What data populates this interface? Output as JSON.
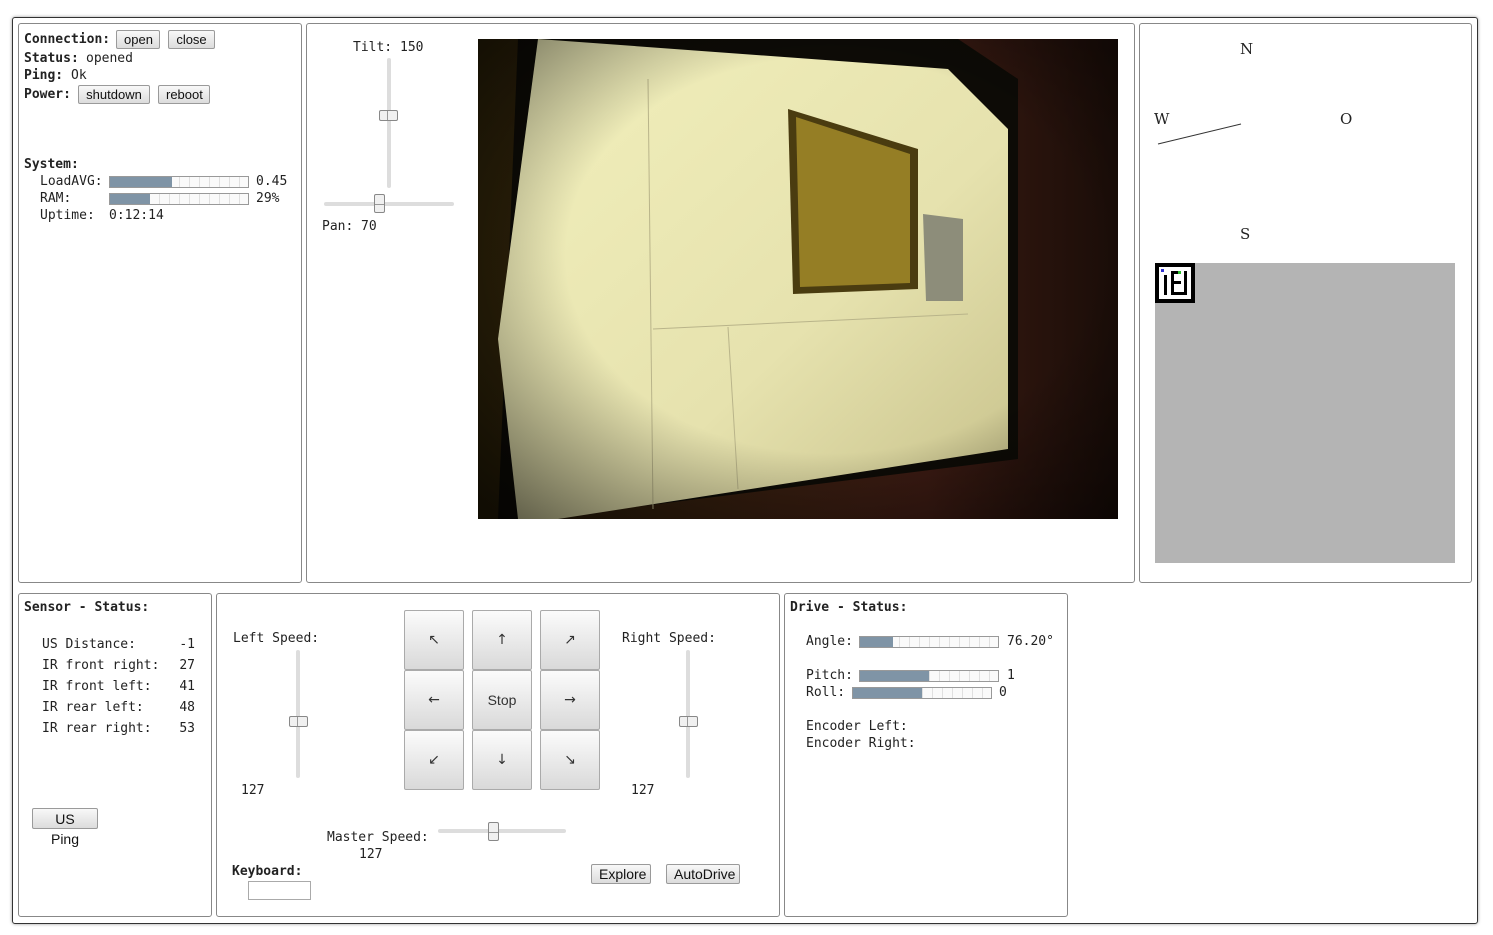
{
  "connection": {
    "label": "Connection:",
    "open_btn": "open",
    "close_btn": "close",
    "status_label": "Status:",
    "status_value": "opened",
    "ping_label": "Ping:",
    "ping_value": "Ok",
    "power_label": "Power:",
    "shutdown_btn": "shutdown",
    "reboot_btn": "reboot"
  },
  "system": {
    "label": "System:",
    "load_label": "LoadAVG:",
    "load_value": "0.45",
    "load_fraction": 0.45,
    "ram_label": "RAM:",
    "ram_value": "29%",
    "ram_fraction": 0.29,
    "uptime_label": "Uptime:",
    "uptime_value": "0:12:14"
  },
  "camera": {
    "tilt_label": "Tilt:",
    "tilt_value": "150",
    "pan_label": "Pan:",
    "pan_value": "70"
  },
  "compass": {
    "north": "N",
    "south": "S",
    "west": "W",
    "east": "O"
  },
  "sensor": {
    "title": "Sensor - Status:",
    "rows": [
      {
        "label": "US Distance:",
        "value": "-1"
      },
      {
        "label": "IR front right:",
        "value": "27"
      },
      {
        "label": "IR front left:",
        "value": "41"
      },
      {
        "label": "IR rear left:",
        "value": "48"
      },
      {
        "label": "IR rear right:",
        "value": "53"
      }
    ],
    "ping_btn": "US Ping"
  },
  "control": {
    "left_speed_label": "Left Speed:",
    "left_speed_value": "127",
    "right_speed_label": "Right Speed:",
    "right_speed_value": "127",
    "master_speed_label": "Master Speed:",
    "master_speed_value": "127",
    "keyboard_label": "Keyboard:",
    "explore_btn": "Explore",
    "autodrive_btn": "AutoDrive",
    "pad": {
      "up_left": "↖",
      "up": "↑",
      "up_right": "↗",
      "left": "←",
      "stop": "Stop",
      "right": "→",
      "down_left": "↙",
      "down": "↓",
      "down_right": "↘"
    }
  },
  "drive": {
    "title": "Drive - Status:",
    "angle_label": "Angle:",
    "angle_value": "76.20°",
    "angle_fraction": 0.24,
    "pitch_label": "Pitch:",
    "pitch_value": "1",
    "pitch_fraction": 0.5,
    "roll_label": "Roll:",
    "roll_value": "0",
    "roll_fraction": 0.5,
    "encoder_left_label": "Encoder Left:",
    "encoder_right_label": "Encoder Right:"
  },
  "colors": {
    "bar_fill": "#7f94a6",
    "map_bg": "#b4b4b4"
  }
}
